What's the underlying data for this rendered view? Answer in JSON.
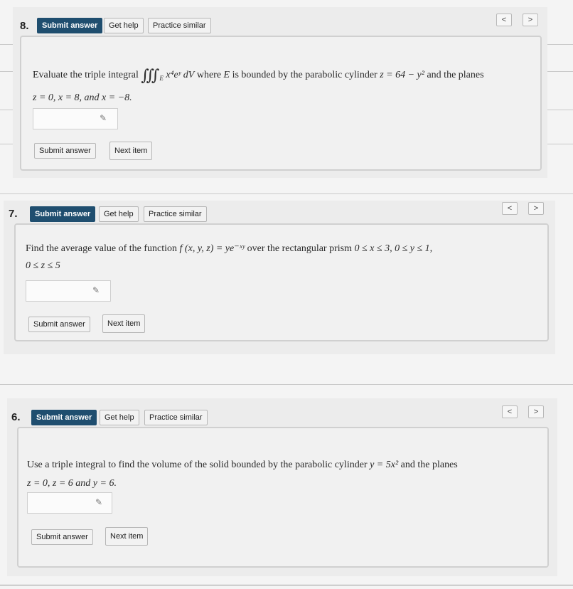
{
  "questions": [
    {
      "number": "8.",
      "buttons": {
        "submit": "Submit answer",
        "help": "Get help",
        "similar": "Practice similar"
      },
      "nav": {
        "prev": "<",
        "next": ">"
      },
      "text": {
        "a": "Evaluate the triple integral",
        "integral": "∭",
        "sub": "E",
        "integrand": "x⁴eʸ dV",
        "b": "where",
        "E": "E",
        "c": "is bounded by the parabolic cylinder",
        "surface": "z = 64 − y²",
        "d": "and the planes",
        "line2": "z = 0, x = 8, and x = −8."
      },
      "bottom": {
        "submit": "Submit answer",
        "next": "Next item"
      }
    },
    {
      "number": "7.",
      "buttons": {
        "submit": "Submit answer",
        "help": "Get help",
        "similar": "Practice similar"
      },
      "nav": {
        "prev": "<",
        "next": ">"
      },
      "text": {
        "a": "Find the average value of the function",
        "func": "f (x, y, z) = ye⁻ˣʸ",
        "b": "over the rectangular prism",
        "range": "0 ≤ x ≤ 3, 0 ≤ y ≤ 1,",
        "line2": "0 ≤ z ≤ 5"
      },
      "bottom": {
        "submit": "Submit answer",
        "next": "Next item"
      }
    },
    {
      "number": "6.",
      "buttons": {
        "submit": "Submit answer",
        "help": "Get help",
        "similar": "Practice similar"
      },
      "nav": {
        "prev": "<",
        "next": ">"
      },
      "text": {
        "a": "Use a triple integral to find the volume of the solid bounded by the parabolic cylinder",
        "surface": "y = 5x²",
        "b": "and the planes",
        "line2": "z = 0, z = 6 and y = 6."
      },
      "bottom": {
        "submit": "Submit answer",
        "next": "Next item"
      }
    }
  ],
  "icons": {
    "pencil": "✎"
  }
}
